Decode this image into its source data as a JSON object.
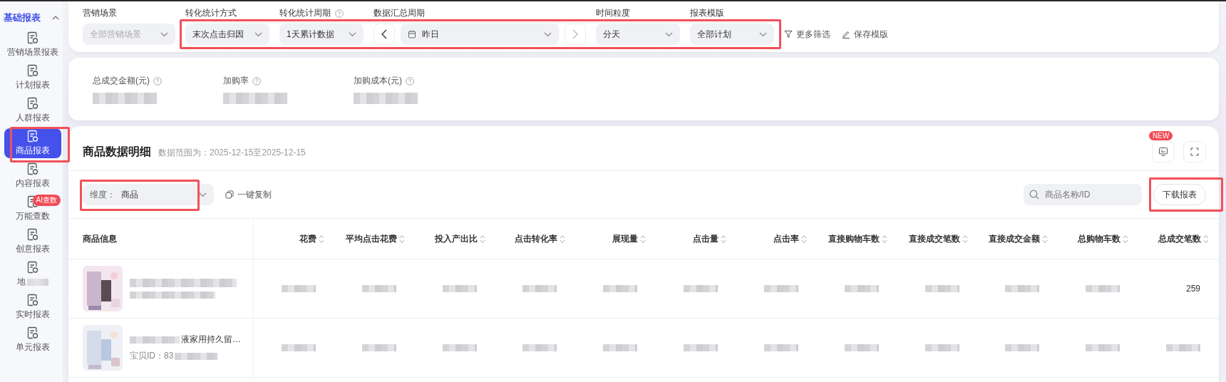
{
  "sidebar": {
    "group": {
      "label": "基础报表",
      "expanded": true
    },
    "items": [
      {
        "label": "营销场景报表",
        "selected": false,
        "highlighted": false,
        "obscured": false
      },
      {
        "label": "计划报表",
        "selected": false,
        "highlighted": false,
        "obscured": false
      },
      {
        "label": "人群报表",
        "selected": false,
        "highlighted": false,
        "obscured": false
      },
      {
        "label": "商品报表",
        "selected": true,
        "highlighted": true,
        "obscured": false
      },
      {
        "label": "内容报表",
        "selected": false,
        "highlighted": false,
        "obscured": false
      },
      {
        "label": "万能查数",
        "badge": "AI查数",
        "selected": false,
        "highlighted": false,
        "obscured": false
      },
      {
        "label": "创意报表",
        "selected": false,
        "highlighted": false,
        "obscured": false
      },
      {
        "label": "地",
        "selected": false,
        "highlighted": false,
        "obscured": true
      },
      {
        "label": "实时报表",
        "selected": false,
        "highlighted": false,
        "obscured": false
      },
      {
        "label": "单元报表",
        "selected": false,
        "highlighted": false,
        "obscured": false
      }
    ]
  },
  "filters": [
    {
      "label": "营销场景",
      "value": "全部营销场景",
      "kind": "select",
      "help": false,
      "disabled": true,
      "highlighted": false
    },
    {
      "label": "转化统计方式",
      "value": "末次点击归因",
      "kind": "select",
      "help": false,
      "disabled": false,
      "highlighted": true
    },
    {
      "label": "转化统计周期",
      "value": "1天累计数据",
      "kind": "select",
      "help": true,
      "disabled": false,
      "highlighted": true
    },
    {
      "label": "数据汇总周期",
      "value": "昨日",
      "kind": "date",
      "help": false,
      "disabled": false,
      "highlighted": true
    },
    {
      "label": "时间粒度",
      "value": "分天",
      "kind": "select",
      "help": false,
      "disabled": false,
      "highlighted": true
    },
    {
      "label": "报表模版",
      "value": "全部计划",
      "kind": "select",
      "help": false,
      "disabled": false,
      "highlighted": true
    }
  ],
  "filter_actions": [
    {
      "label": "更多筛选",
      "kind": "filter"
    },
    {
      "label": "保存模版",
      "kind": "edit"
    }
  ],
  "metrics": [
    {
      "label": "总成交金额(元)"
    },
    {
      "label": "加购率"
    },
    {
      "label": "加购成本(元)"
    }
  ],
  "panel": {
    "title": "商品数据明细",
    "range": "数据范围为：2025-12-15至2025-12-15",
    "badge": "NEW",
    "dimension": {
      "label": "维度：",
      "value": "商品",
      "highlighted": true
    },
    "copy": "一键复制",
    "search": {
      "placeholder": "商品名称/ID"
    },
    "download": {
      "label": "下载报表",
      "highlighted": true
    }
  },
  "table": {
    "columns": [
      {
        "label": "商品信息",
        "sortable": false
      },
      {
        "label": "花费",
        "sortable": true
      },
      {
        "label": "平均点击花费",
        "sortable": true
      },
      {
        "label": "投入产出比",
        "sortable": true
      },
      {
        "label": "点击转化率",
        "sortable": true
      },
      {
        "label": "展现量",
        "sortable": true
      },
      {
        "label": "点击量",
        "sortable": true
      },
      {
        "label": "点击率",
        "sortable": true
      },
      {
        "label": "直接购物车数",
        "sortable": true
      },
      {
        "label": "直接成交笔数",
        "sortable": true
      },
      {
        "label": "直接成交金额",
        "sortable": true
      },
      {
        "label": "总购物车数",
        "sortable": true
      },
      {
        "label": "总成交笔数",
        "sortable": true
      }
    ],
    "rows": [
      {
        "cells": [
          {
            "kind": "product",
            "blurred": true
          },
          {
            "kind": "blurred"
          },
          {
            "kind": "blurred"
          },
          {
            "kind": "blurred"
          },
          {
            "kind": "blurred"
          },
          {
            "kind": "blurred"
          },
          {
            "kind": "blurred"
          },
          {
            "kind": "blurred"
          },
          {
            "kind": "blurred"
          },
          {
            "kind": "blurred"
          },
          {
            "kind": "blurred"
          },
          {
            "kind": "blurred"
          },
          {
            "kind": "text",
            "text": "259"
          }
        ]
      },
      {
        "cells": [
          {
            "kind": "product",
            "blurred": false,
            "title": "液家用持久留…",
            "id": "宝贝ID：83"
          },
          {
            "kind": "blurred"
          },
          {
            "kind": "blurred"
          },
          {
            "kind": "blurred"
          },
          {
            "kind": "blurred"
          },
          {
            "kind": "blurred"
          },
          {
            "kind": "blurred"
          },
          {
            "kind": "blurred"
          },
          {
            "kind": "blurred"
          },
          {
            "kind": "blurred"
          },
          {
            "kind": "blurred"
          },
          {
            "kind": "blurred"
          },
          {
            "kind": "blurred"
          }
        ]
      }
    ]
  }
}
